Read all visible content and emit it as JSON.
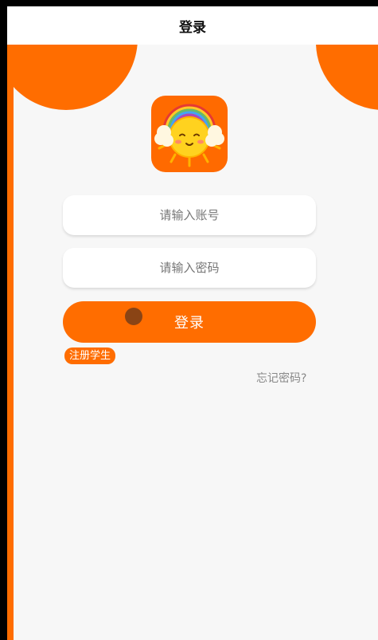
{
  "header": {
    "title": "登录"
  },
  "login_form": {
    "account_placeholder": "请输入账号",
    "password_placeholder": "请输入密码",
    "submit_label": "登录"
  },
  "links": {
    "register_label": "注册学生",
    "forgot_label": "忘记密码?"
  },
  "colors": {
    "accent": "#ff6d00",
    "background": "#f7f7f7",
    "header_bg": "#ffffff"
  },
  "icons": {
    "logo": "sun-with-headphones-icon"
  }
}
